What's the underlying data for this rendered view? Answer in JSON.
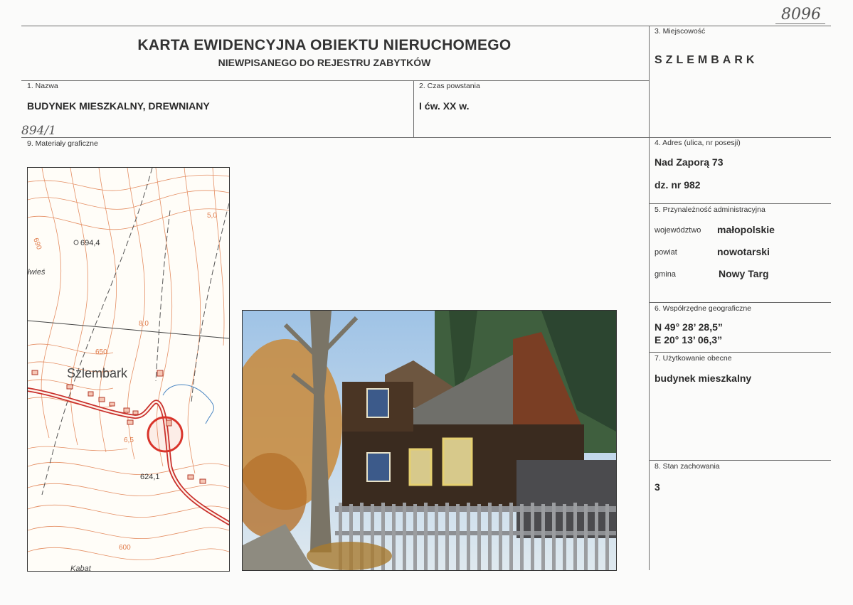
{
  "handwritten": {
    "top_number": "8096",
    "plot_ref": "894/1"
  },
  "header": {
    "title": "KARTA EWIDENCYJNA OBIEKTU NIERUCHOMEGO",
    "subtitle": "NIEWPISANEGO DO REJESTRU ZABYTKÓW"
  },
  "field_3": {
    "label": "3. Miejscowość",
    "value": "SZLEMBARK"
  },
  "field_1": {
    "label": "1. Nazwa",
    "value": "BUDYNEK MIESZKALNY, DREWNIANY"
  },
  "field_2": {
    "label": "2. Czas powstania",
    "value": "I ćw. XX w."
  },
  "field_9": {
    "label": "9. Materiały graficzne"
  },
  "field_4": {
    "label": "4. Adres (ulica, nr posesji)",
    "address": "Nad Zaporą 73",
    "plot": "dz. nr 982"
  },
  "field_5": {
    "label": "5. Przynależność administracyjna",
    "rows": [
      {
        "key": "województwo",
        "value": "małopolskie"
      },
      {
        "key": "powiat",
        "value": "nowotarski"
      },
      {
        "key": "gmina",
        "value": "Nowy Targ"
      }
    ]
  },
  "field_6": {
    "label": "6. Współrzędne geograficzne",
    "lat": "N 49° 28’ 28,5”",
    "lon": "E 20° 13’ 06,3”"
  },
  "field_7": {
    "label": "7. Użytkowanie obecne",
    "value": "budynek mieszkalny"
  },
  "field_8": {
    "label": "8. Stan zachowania",
    "value": "3"
  },
  "map": {
    "labels": {
      "elev1": "694,4",
      "place": "Szlembark",
      "elev2": "624,1",
      "fragment_left": "łwieś",
      "fragment_bottom": "Kabat",
      "contour_690": "690",
      "contour_650": "650",
      "contour_600": "600",
      "km1": "5,0",
      "km2": "8,0",
      "km3": "6,5"
    },
    "colors": {
      "contour": "#e07b4a",
      "road": "#c9302c",
      "marker": "#d9342b"
    }
  }
}
